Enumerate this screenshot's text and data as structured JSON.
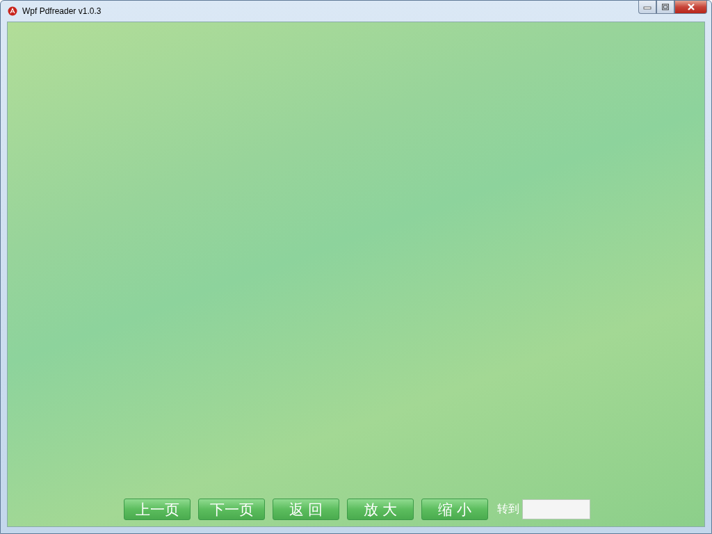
{
  "window": {
    "title": "Wpf Pdfreader v1.0.3"
  },
  "toolbar": {
    "buttons": [
      "上一页",
      "下一页",
      "返 回",
      "放 大",
      "缩 小"
    ],
    "goto": {
      "label": "转到"
    }
  }
}
